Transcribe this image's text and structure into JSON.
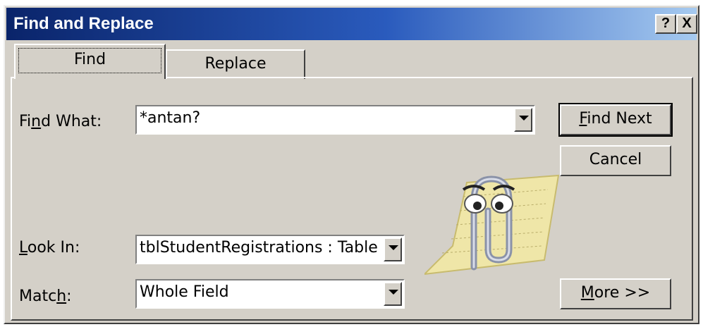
{
  "window": {
    "title": "Find and Replace",
    "help_label": "?",
    "close_label": "X"
  },
  "tabs": [
    {
      "label": "Find",
      "active": true
    },
    {
      "label": "Replace",
      "active": false
    }
  ],
  "find_what": {
    "label_pre": "Fi",
    "label_hotkey": "n",
    "label_post": "d What:",
    "value": "*antan?"
  },
  "look_in": {
    "label_pre": "",
    "label_hotkey": "L",
    "label_post": "ook In:",
    "value": "tblStudentRegistrations : Table"
  },
  "match": {
    "label_pre": "Matc",
    "label_hotkey": "h",
    "label_post": ":",
    "value": "Whole Field"
  },
  "buttons": {
    "find_next": {
      "hotkey": "F",
      "rest": "ind Next"
    },
    "cancel": "Cancel",
    "more": {
      "hotkey": "M",
      "rest": "ore >>"
    }
  },
  "assistant": {
    "icon": "office-assistant-paperclip-icon"
  },
  "colors": {
    "face": "#d4d0c8",
    "title_start": "#0a246a",
    "title_end": "#a6caf0"
  }
}
